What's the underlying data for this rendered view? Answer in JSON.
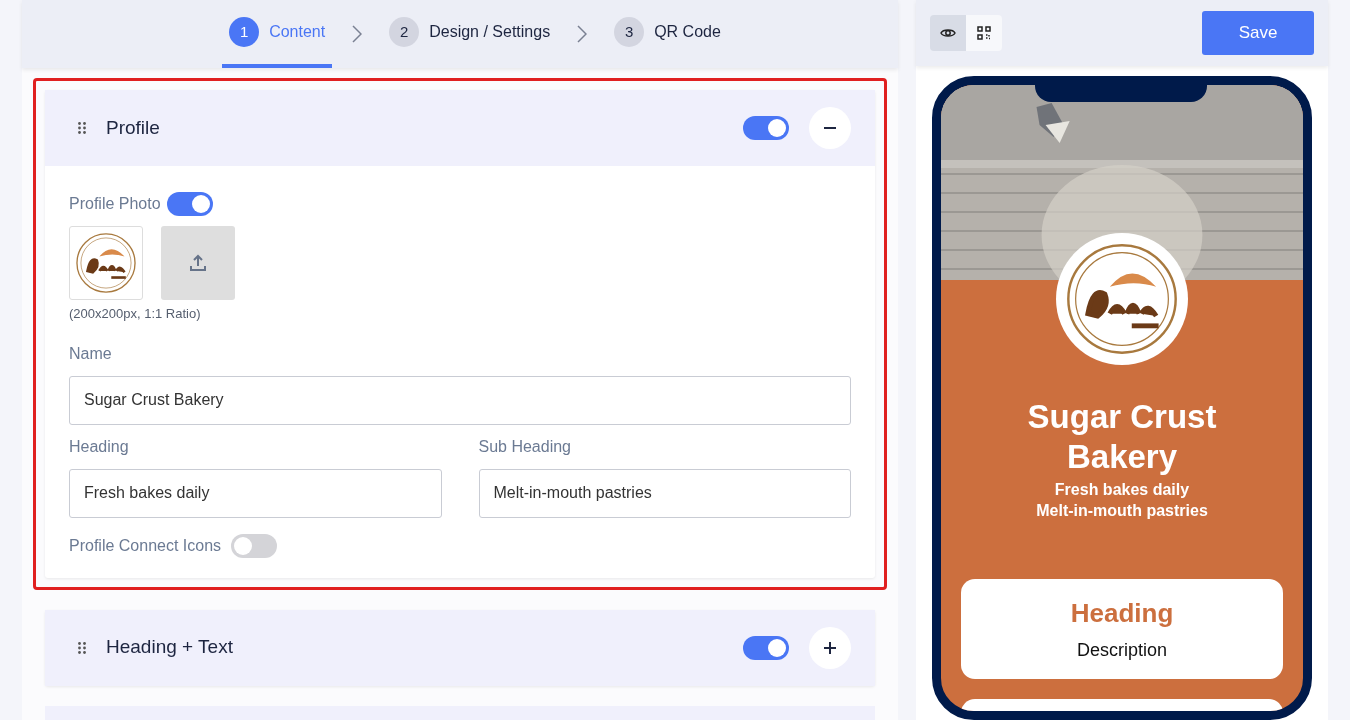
{
  "steps": [
    {
      "number": "1",
      "label": "Content",
      "selected": true
    },
    {
      "number": "2",
      "label": "Design / Settings",
      "selected": false
    },
    {
      "number": "3",
      "label": "QR Code",
      "selected": false
    }
  ],
  "sections": [
    {
      "title": "Profile",
      "enabled": true,
      "expanded": true,
      "highlighted": true,
      "profile_photo": {
        "label": "Profile Photo",
        "on": true,
        "hint": "(200x200px, 1:1 Ratio)"
      },
      "name": {
        "label": "Name",
        "value": "Sugar Crust Bakery"
      },
      "heading": {
        "label": "Heading",
        "value": "Fresh bakes daily"
      },
      "sub_heading": {
        "label": "Sub Heading",
        "value": "Melt-in-mouth pastries"
      },
      "connect_icons": {
        "label": "Profile Connect Icons",
        "on": false
      }
    },
    {
      "title": "Heading + Text",
      "enabled": true,
      "expanded": false,
      "highlighted": false
    }
  ],
  "preview": {
    "views": [
      {
        "kind": "preview",
        "selected": true
      },
      {
        "kind": "qr",
        "selected": false
      }
    ],
    "save": "Save",
    "phone": {
      "name": "Sugar Crust Bakery",
      "heading": "Fresh bakes daily",
      "sub_heading": "Melt-in-mouth pastries",
      "card": {
        "heading": "Heading",
        "description": "Description"
      }
    }
  }
}
